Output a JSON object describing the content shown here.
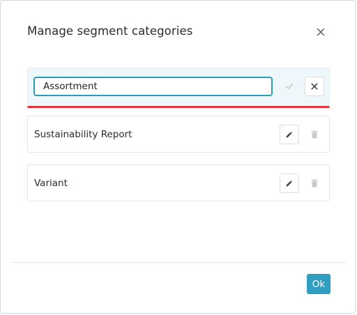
{
  "dialog": {
    "title": "Manage segment categories"
  },
  "editing_row": {
    "input_value": "Assortment"
  },
  "categories": [
    {
      "label": "Sustainability Report"
    },
    {
      "label": "Variant"
    }
  ],
  "footer": {
    "ok_label": "Ok"
  },
  "colors": {
    "accent": "#2f9ec0",
    "input_focus_border": "#2a9cba",
    "error_underline": "#e0383e",
    "editing_row_bg": "#eef8fb",
    "disabled_icon": "#c8c8c8",
    "icon": "#444444"
  },
  "icons": {
    "close": "close-icon",
    "confirm": "check-icon",
    "cancel": "close-icon",
    "edit": "pencil-icon",
    "delete": "trash-icon"
  }
}
